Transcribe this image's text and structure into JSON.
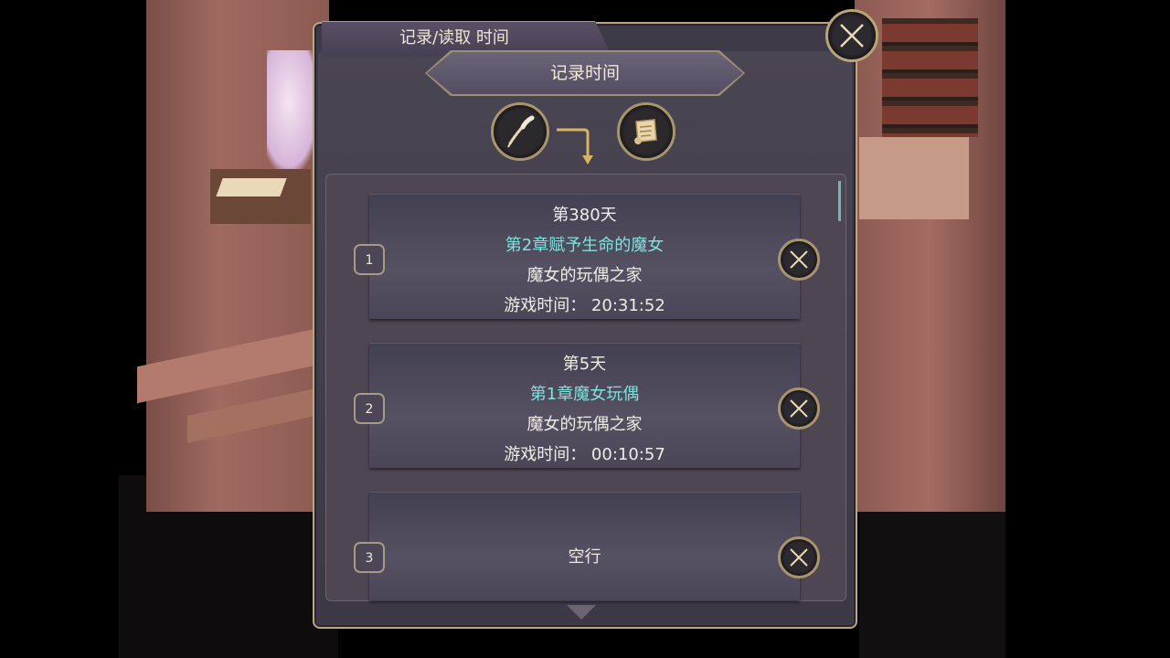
{
  "dialog": {
    "title": "记录/读取 时间",
    "subtitle": "记录时间"
  },
  "icons": {
    "close": "close-icon",
    "quill": "quill-icon",
    "arrow": "arrow-down-icon",
    "scroll": "scroll-icon",
    "delete": "delete-icon"
  },
  "colors": {
    "chapter_text": "#7fe3dd",
    "frame_gold": "#b8a77f",
    "panel": "#3f3a48"
  },
  "slots": [
    {
      "number": "1",
      "day": "第380天",
      "chapter": "第2章赋予生命的魔女",
      "location": "魔女的玩偶之家",
      "playtime": "游戏时间： 20:31:52"
    },
    {
      "number": "2",
      "day": "第5天",
      "chapter": "第1章魔女玩偶",
      "location": "魔女的玩偶之家",
      "playtime": "游戏时间： 00:10:57"
    },
    {
      "number": "3",
      "empty_label": "空行"
    }
  ]
}
